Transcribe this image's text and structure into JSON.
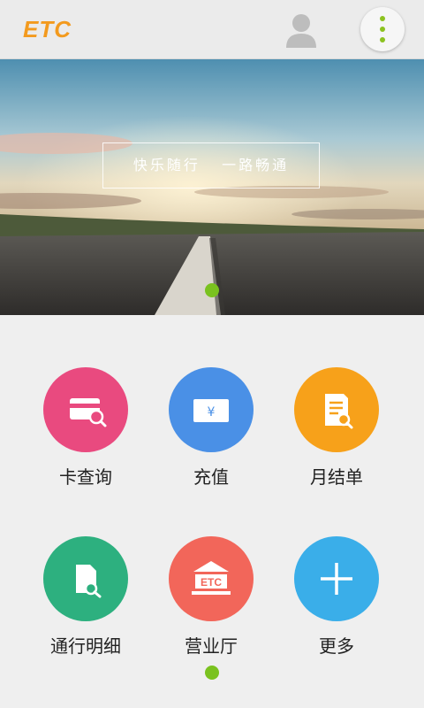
{
  "header": {
    "logo_text": "ETC",
    "icons": [
      "user-avatar-icon",
      "more-menu-icon"
    ]
  },
  "banner": {
    "slogan": "快乐随行   一路畅通",
    "carousel_pages": 1
  },
  "grid": {
    "items": [
      {
        "label": "卡查询",
        "icon": "card-search-icon",
        "color": "#e94a7f"
      },
      {
        "label": "充值",
        "icon": "recharge-icon",
        "color": "#4a90e6"
      },
      {
        "label": "月结单",
        "icon": "monthly-statement-icon",
        "color": "#f7a11a"
      },
      {
        "label": "通行明细",
        "icon": "toll-detail-icon",
        "color": "#2db07f"
      },
      {
        "label": "营业厅",
        "icon": "service-hall-icon",
        "color": "#f2665a"
      },
      {
        "label": "更多",
        "icon": "plus-icon",
        "color": "#3aaee9"
      }
    ],
    "rec_symbol": "¥",
    "hall_symbol": "ETC"
  },
  "colors": {
    "accent": "#7ac21f",
    "logo": "#f39a1e"
  }
}
